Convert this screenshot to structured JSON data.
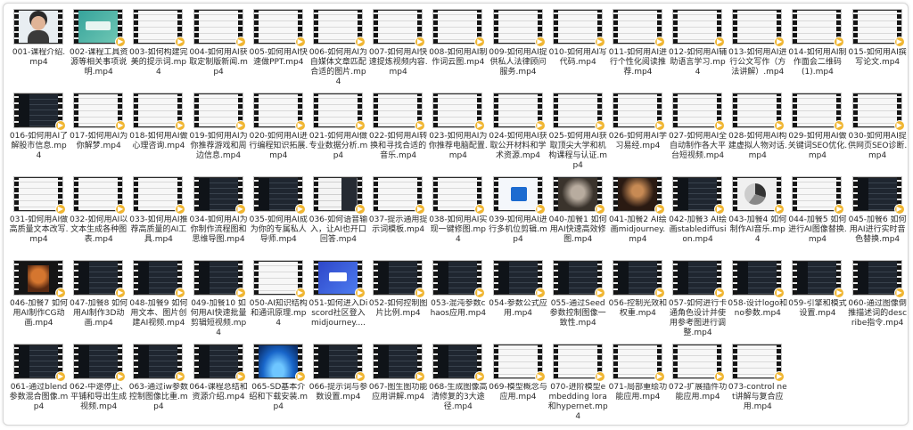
{
  "files": [
    {
      "name": "001-课程介绍.mp4",
      "thumb": "face",
      "badge": false
    },
    {
      "name": "002-课程工具资源等相关事项说明.mp4",
      "thumb": "teal",
      "badge": true
    },
    {
      "name": "003-如何构建完美的提示词.mp4",
      "thumb": "light",
      "badge": true
    },
    {
      "name": "004-如何用AI获取定制版新闻.mp4",
      "thumb": "light",
      "badge": true
    },
    {
      "name": "005-如何用AI快速做PPT.mp4",
      "thumb": "light",
      "badge": true
    },
    {
      "name": "006-如何用AI为自媒体文章匹配合适的图片.mp4",
      "thumb": "light",
      "badge": true
    },
    {
      "name": "007-如何用AI快速提炼视频内容.mp4",
      "thumb": "light",
      "badge": true
    },
    {
      "name": "008-如何用AI制作词云图.mp4",
      "thumb": "light",
      "badge": true
    },
    {
      "name": "009-如何用AI提供私人法律顾问服务.mp4",
      "thumb": "light",
      "badge": true
    },
    {
      "name": "010-如何用AI写代码.mp4",
      "thumb": "light",
      "badge": true
    },
    {
      "name": "011-如何用AI进行个性化阅读推荐.mp4",
      "thumb": "light",
      "badge": true
    },
    {
      "name": "012-如何用AI辅助语言学习.mp4",
      "thumb": "light",
      "badge": true
    },
    {
      "name": "013-如何用AI进行公文写作（方法讲解）.mp4",
      "thumb": "light",
      "badge": true
    },
    {
      "name": "014-如何用AI制作面会二维码(1).mp4",
      "thumb": "light",
      "badge": true
    },
    {
      "name": "015-如何用AI撰写论文.mp4",
      "thumb": "light",
      "badge": true
    },
    {
      "name": "016-如何用AI了解股市信息.mp4",
      "thumb": "dark",
      "badge": true
    },
    {
      "name": "017-如何用AI为你解梦.mp4",
      "thumb": "light",
      "badge": true
    },
    {
      "name": "018-如何用AI做心理咨询.mp4",
      "thumb": "light",
      "badge": true
    },
    {
      "name": "019-如何用AI为你推荐游戏和周边信息.mp4",
      "thumb": "light",
      "badge": true
    },
    {
      "name": "020-如何用AI进行编程知识拓展.mp4",
      "thumb": "light",
      "badge": true
    },
    {
      "name": "021-如何用AI做专业数据分析.mp4",
      "thumb": "light",
      "badge": true
    },
    {
      "name": "022-如何用AI转换和寻找合适的音乐.mp4",
      "thumb": "light",
      "badge": true
    },
    {
      "name": "023-如何用AI为你推荐电脑配置.mp4",
      "thumb": "light",
      "badge": true
    },
    {
      "name": "024-如何用AI获取公开材料和学术资源.mp4",
      "thumb": "light",
      "badge": true
    },
    {
      "name": "025-如何用AI获取顶尖大学和机构课程与认证.mp4",
      "thumb": "light",
      "badge": true
    },
    {
      "name": "026-如何用AI学习易经.mp4",
      "thumb": "light",
      "badge": true
    },
    {
      "name": "027-如何用AI全自动制作各大平台短视频.mp4",
      "thumb": "light",
      "badge": true
    },
    {
      "name": "028-如何用AI构建虚拟人物对话.mp4",
      "thumb": "light",
      "badge": true
    },
    {
      "name": "029-如何用AI做关键词SEO优化.mp4",
      "thumb": "light",
      "badge": true
    },
    {
      "name": "030-如何用AI提供网页SEO诊断.mp4",
      "thumb": "light",
      "badge": true
    },
    {
      "name": "031-如何用AI做高质量文本改写.mp4",
      "thumb": "light",
      "badge": true
    },
    {
      "name": "032-如何用AI以文本生成各种图表.mp4",
      "thumb": "light",
      "badge": true
    },
    {
      "name": "033-如何用AI推荐高质量的AI工具.mp4",
      "thumb": "light",
      "badge": true
    },
    {
      "name": "034-如何用AI为你制作流程图和思维导图.mp4",
      "thumb": "dark",
      "badge": true
    },
    {
      "name": "035-如何用AI成为你的专属私人导师.mp4",
      "thumb": "dark",
      "badge": true
    },
    {
      "name": "036-如何语音输入，让AI也开口回答.mp4",
      "thumb": "mix",
      "badge": true
    },
    {
      "name": "037-提示通用提示词模板.mp4",
      "thumb": "light",
      "badge": true
    },
    {
      "name": "038-如何用AI实现一键修图.mp4",
      "thumb": "light",
      "badge": true
    },
    {
      "name": "039-如何用AI进行多机位剪辑.mp4",
      "thumb": "logo",
      "badge": true
    },
    {
      "name": "040-加餐1 如何用AI快速高效修图.mp4",
      "thumb": "photo",
      "badge": true
    },
    {
      "name": "041-加餐2 AI绘画midjourney.mp4",
      "thumb": "portrait",
      "badge": true
    },
    {
      "name": "042-加餐3 AI绘画stablediffusion.mp4",
      "thumb": "dark",
      "badge": true
    },
    {
      "name": "043-加餐4 如何制作AI音乐.mp4",
      "thumb": "pie",
      "badge": true
    },
    {
      "name": "044-加餐5 如何进行AI图像替换.mp4",
      "thumb": "light",
      "badge": true
    },
    {
      "name": "045-加餐6 如何用AI进行实时音色替换.mp4",
      "thumb": "dark",
      "badge": true
    },
    {
      "name": "046-加餐7 如何用AI制作CG动画.mp4",
      "thumb": "hero",
      "badge": true
    },
    {
      "name": "047-加餐8 如何用AI制作3D动画.mp4",
      "thumb": "dark",
      "badge": true
    },
    {
      "name": "048-加餐9 如何用文本、图片创建AI视频.mp4",
      "thumb": "dark",
      "badge": true
    },
    {
      "name": "049-加餐10 如何用AI快速批量剪辑短视频.mp4",
      "thumb": "dark",
      "badge": true
    },
    {
      "name": "050-AI知识结构和通讯原理.mp4",
      "thumb": "light",
      "badge": true
    },
    {
      "name": "051-如何进入Discord社区登入midjourney....",
      "thumb": "blue",
      "badge": true
    },
    {
      "name": "052-如何控制图片比例.mp4",
      "thumb": "dark",
      "badge": true
    },
    {
      "name": "053-混沌参数chaos应用.mp4",
      "thumb": "dark",
      "badge": true
    },
    {
      "name": "054-参数公式应用.mp4",
      "thumb": "dark",
      "badge": true
    },
    {
      "name": "055-通过Seed参数控制图像一致性.mp4",
      "thumb": "dark",
      "badge": true
    },
    {
      "name": "056-控制光效和权重.mp4",
      "thumb": "dark",
      "badge": true
    },
    {
      "name": "057-如何进行卡通角色设计并使用参考图进行调整.mp4",
      "thumb": "dark",
      "badge": true
    },
    {
      "name": "058-设计logo和no参数.mp4",
      "thumb": "dark",
      "badge": true
    },
    {
      "name": "059-引擎和模式设置.mp4",
      "thumb": "dark",
      "badge": true
    },
    {
      "name": "060-通过图像倒推描述词的describe指令.mp4",
      "thumb": "dark",
      "badge": true
    },
    {
      "name": "061-通过blend参数混合图像.mp4",
      "thumb": "dark",
      "badge": true
    },
    {
      "name": "062-中途停止、平铺和导出生成视频.mp4",
      "thumb": "dark",
      "badge": true
    },
    {
      "name": "063-通过iw参数控制图像比重.mp4",
      "thumb": "dark",
      "badge": true
    },
    {
      "name": "064-课程总结和资源介绍.mp4",
      "thumb": "dark",
      "badge": true
    },
    {
      "name": "065-SD基本介绍和下载安装.mp4",
      "thumb": "win",
      "badge": true
    },
    {
      "name": "066-提示词与参数设置.mp4",
      "thumb": "dark",
      "badge": true
    },
    {
      "name": "067-图生图功能应用讲解.mp4",
      "thumb": "dark",
      "badge": true
    },
    {
      "name": "068-生成图像高清修复的3大途径.mp4",
      "thumb": "dark",
      "badge": true
    },
    {
      "name": "069-模型概念与应用.mp4",
      "thumb": "light",
      "badge": true
    },
    {
      "name": "070-进阶模型embedding lora 和hypernet.mp4",
      "thumb": "light",
      "badge": true
    },
    {
      "name": "071-局部重绘功能应用.mp4",
      "thumb": "light",
      "badge": true
    },
    {
      "name": "072-扩展插件功能应用.mp4",
      "thumb": "light",
      "badge": true
    },
    {
      "name": "073-control net讲解与复合应用.mp4",
      "thumb": "light",
      "badge": true
    }
  ],
  "badge_color": "#f0b632",
  "badge_icon": "play-badge-icon"
}
